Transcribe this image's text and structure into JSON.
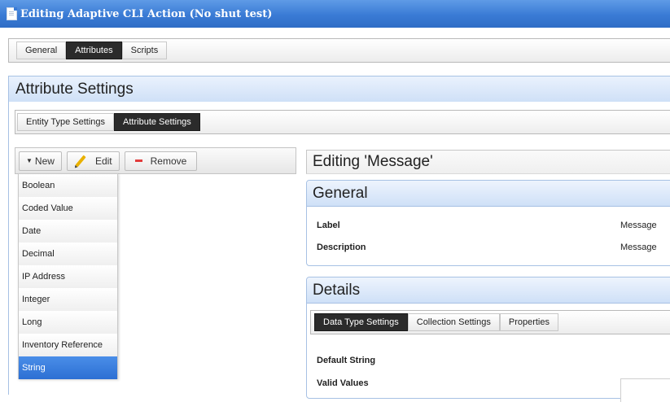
{
  "window": {
    "title": "Editing Adaptive CLI Action (No shut test)"
  },
  "tabs": [
    {
      "label": "General",
      "active": false
    },
    {
      "label": "Attributes",
      "active": true
    },
    {
      "label": "Scripts",
      "active": false
    }
  ],
  "attribute_settings": {
    "title": "Attribute Settings",
    "subtabs": [
      {
        "label": "Entity Type Settings",
        "active": false
      },
      {
        "label": "Attribute Settings",
        "active": true
      }
    ]
  },
  "toolbar": {
    "new_label": "New",
    "edit_label": "Edit",
    "remove_label": "Remove"
  },
  "new_menu": {
    "items": [
      "Boolean",
      "Coded Value",
      "Date",
      "Decimal",
      "IP Address",
      "Integer",
      "Long",
      "Inventory Reference",
      "String"
    ],
    "selected": "String"
  },
  "editor": {
    "title": "Editing 'Message'",
    "general": {
      "title": "General",
      "fields": [
        {
          "label": "Label",
          "value": "Message"
        },
        {
          "label": "Description",
          "value": "Message"
        }
      ]
    },
    "details": {
      "title": "Details",
      "tabs": [
        {
          "label": "Data Type Settings",
          "active": true
        },
        {
          "label": "Collection Settings",
          "active": false
        },
        {
          "label": "Properties",
          "active": false
        }
      ],
      "fields": [
        {
          "label": "Default String"
        },
        {
          "label": "Valid Values"
        }
      ]
    }
  },
  "colors": {
    "titlebar": "#3a7bd5",
    "active_tab": "#2b2b2b",
    "panel_header": "#cfe0f7",
    "selected_item": "#2c6fd3",
    "remove_icon": "#e23b3b",
    "edit_icon": "#e9b100"
  },
  "icons": {
    "window": "document-icon",
    "new": "caret-down-icon",
    "edit": "pencil-icon",
    "remove": "minus-icon"
  }
}
